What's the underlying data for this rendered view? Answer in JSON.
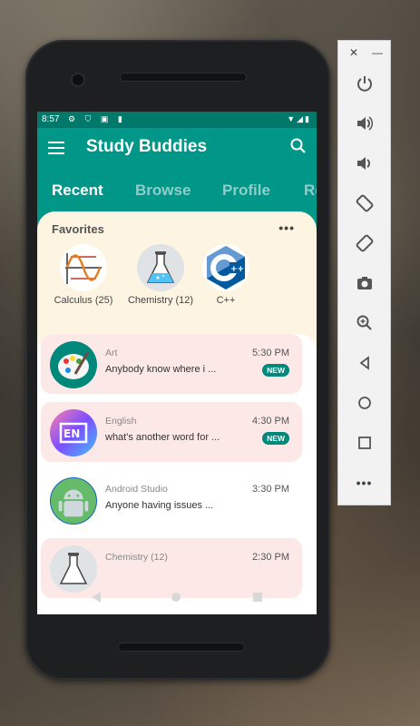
{
  "status": {
    "time": "8:57"
  },
  "appbar": {
    "title": "Study Buddies"
  },
  "tabs": [
    "Recent",
    "Browse",
    "Profile",
    "Re"
  ],
  "favorites": {
    "title": "Favorites",
    "items": [
      {
        "label": "Calculus (25)",
        "icon": "calculus-graph-icon"
      },
      {
        "label": "Chemistry (12)",
        "icon": "chemistry-flask-icon"
      },
      {
        "label": "C++",
        "icon": "cpp-logo-icon"
      }
    ]
  },
  "chats": [
    {
      "name": "Art",
      "message": "Anybody know where i ...",
      "time": "5:30 PM",
      "badge": "NEW",
      "icon": "palette-icon"
    },
    {
      "name": "English",
      "message": "what's another word for ...",
      "time": "4:30 PM",
      "badge": "NEW",
      "icon": "english-en-icon"
    },
    {
      "name": "Android Studio",
      "message": "Anyone having issues ...",
      "time": "3:30 PM",
      "icon": "android-icon"
    },
    {
      "name": "Chemistry (12)",
      "message": "",
      "time": "2:30 PM",
      "icon": "chemistry-flask-icon"
    }
  ],
  "colors": {
    "primary": "#009688",
    "statusbar": "#00796b",
    "favorites_bg": "#fdf5e2",
    "highlight_row": "#fde8e8",
    "badge": "#00897b"
  },
  "emulator_controls": [
    "close-icon",
    "minimize-icon",
    "power-icon",
    "volume-up-icon",
    "volume-down-icon",
    "rotate-left-icon",
    "rotate-right-icon",
    "camera-icon",
    "zoom-icon",
    "back-icon",
    "home-icon",
    "overview-icon",
    "more-icon"
  ]
}
